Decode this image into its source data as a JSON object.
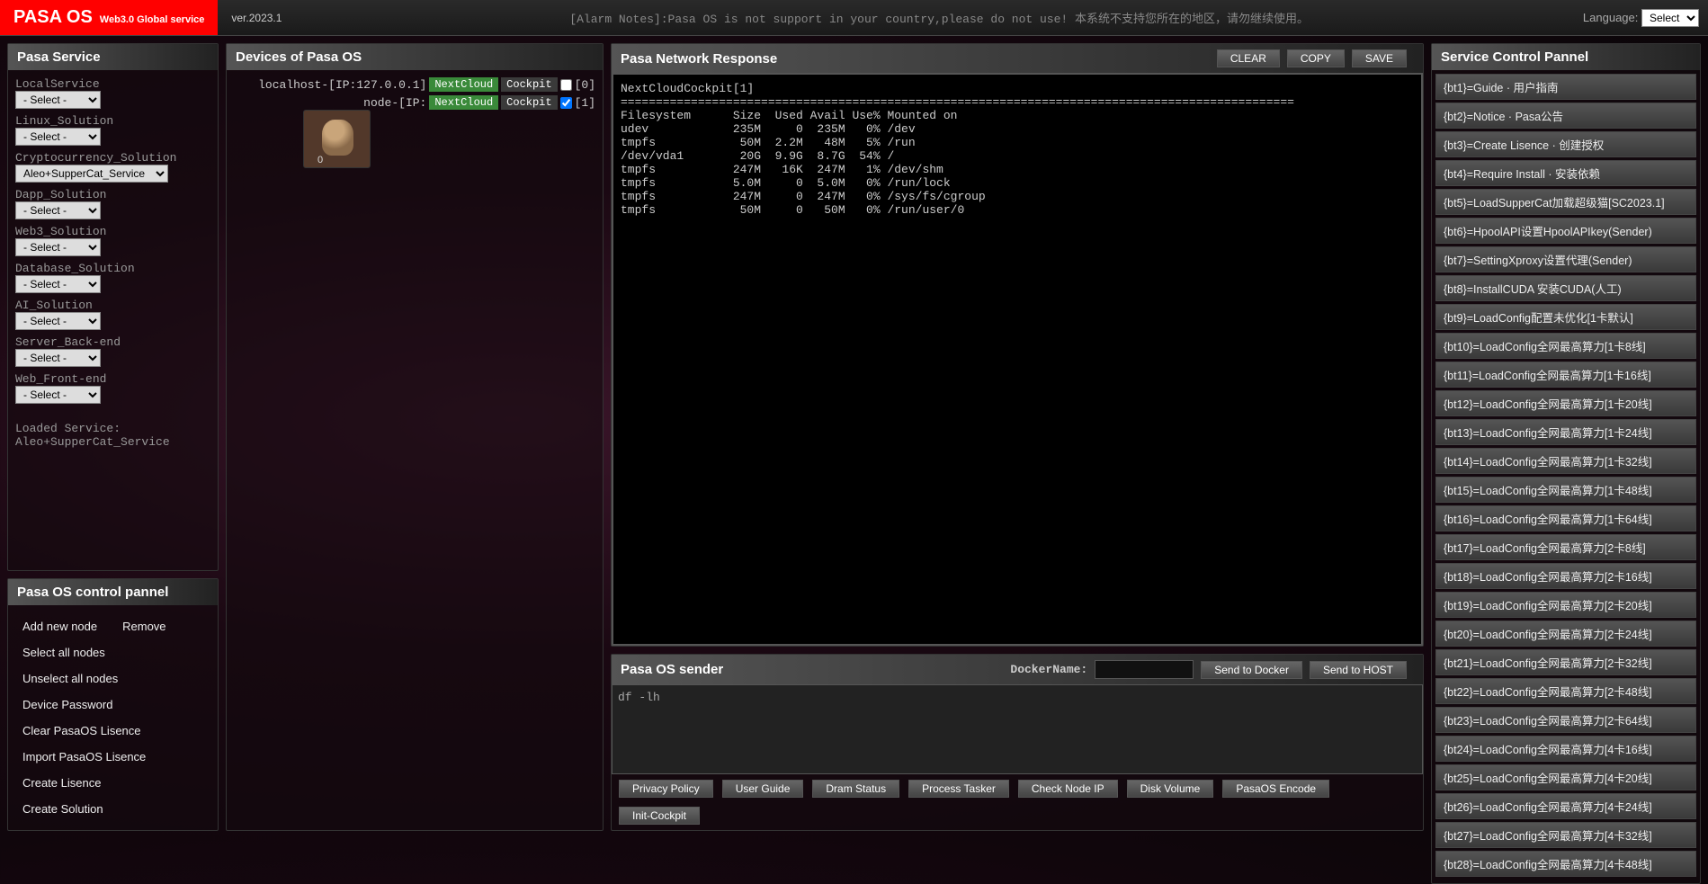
{
  "header": {
    "logo_big": "PASA  OS",
    "logo_small": "Web3.0 Global service",
    "version": "ver.2023.1",
    "alarm": "[Alarm Notes]:Pasa OS is not support in your country,please do not use! 本系统不支持您所在的地区，请勿继续使用。",
    "lang_label": "Language:",
    "lang_value": "Select"
  },
  "service": {
    "title": "Pasa Service",
    "groups": [
      {
        "label": "LocalService",
        "value": "- Select -"
      },
      {
        "label": "Linux_Solution",
        "value": "- Select -"
      },
      {
        "label": "Cryptocurrency_Solution",
        "value": "Aleo+SupperCat_Service"
      },
      {
        "label": "Dapp_Solution",
        "value": "- Select -"
      },
      {
        "label": "Web3_Solution",
        "value": "- Select -"
      },
      {
        "label": "Database_Solution",
        "value": "- Select -"
      },
      {
        "label": "AI_Solution",
        "value": "- Select -"
      },
      {
        "label": "Server_Back-end",
        "value": "- Select -"
      },
      {
        "label": "Web_Front-end",
        "value": "- Select -"
      }
    ],
    "loaded_label": "Loaded Service:",
    "loaded_value": "Aleo+SupperCat_Service"
  },
  "devices": {
    "title": "Devices of Pasa OS",
    "rows": [
      {
        "name": "localhost-[IP:127.0.0.1]",
        "b1": "NextCloud",
        "b2": "Cockpit",
        "checked": false,
        "idx": "[0]"
      },
      {
        "name": "node-[IP:",
        "b1": "NextCloud",
        "b2": "Cockpit",
        "checked": true,
        "idx": "[1]"
      }
    ]
  },
  "response": {
    "title": "Pasa Network Response",
    "btns": {
      "clear": "CLEAR",
      "copy": "COPY",
      "save": "SAVE"
    },
    "text": "NextCloudCockpit[1]\n================================================================================================\nFilesystem      Size  Used Avail Use% Mounted on\nudev            235M     0  235M   0% /dev\ntmpfs            50M  2.2M   48M   5% /run\n/dev/vda1        20G  9.9G  8.7G  54% /\ntmpfs           247M   16K  247M   1% /dev/shm\ntmpfs           5.0M     0  5.0M   0% /run/lock\ntmpfs           247M     0  247M   0% /sys/fs/cgroup\ntmpfs            50M     0   50M   0% /run/user/0"
  },
  "sender": {
    "title": "Pasa OS sender",
    "docker_label": "DockerName:",
    "send_docker": "Send to Docker",
    "send_host": "Send to HOST",
    "cmd": "df -lh",
    "btns": [
      "Privacy Policy",
      "User Guide",
      "Dram Status",
      "Process Tasker",
      "Check Node IP",
      "Disk Volume",
      "PasaOS Encode",
      "Init-Cockpit"
    ]
  },
  "control": {
    "title": "Pasa OS control pannel",
    "btns": [
      "Add new node",
      "Remove",
      "Select all nodes",
      "Unselect all nodes",
      "Device Password",
      "Clear PasaOS Lisence",
      "Import PasaOS Lisence",
      "Create Lisence",
      "Create Solution"
    ]
  },
  "scp": {
    "title": "Service Control Pannel",
    "items": [
      "{bt1}=Guide · 用户指南",
      "{bt2}=Notice · Pasa公告",
      "{bt3}=Create Lisence · 创建授权",
      "{bt4}=Require Install · 安装依赖",
      "{bt5}=LoadSupperCat加载超级猫[SC2023.1]",
      "{bt6}=HpoolAPI设置HpoolAPIkey(Sender)",
      "{bt7}=SettingXproxy设置代理(Sender)",
      "{bt8}=InstallCUDA 安装CUDA(人工)",
      "{bt9}=LoadConfig配置未优化[1卡默认]",
      "{bt10}=LoadConfig全网最高算力[1卡8线]",
      "{bt11}=LoadConfig全网最高算力[1卡16线]",
      "{bt12}=LoadConfig全网最高算力[1卡20线]",
      "{bt13}=LoadConfig全网最高算力[1卡24线]",
      "{bt14}=LoadConfig全网最高算力[1卡32线]",
      "{bt15}=LoadConfig全网最高算力[1卡48线]",
      "{bt16}=LoadConfig全网最高算力[1卡64线]",
      "{bt17}=LoadConfig全网最高算力[2卡8线]",
      "{bt18}=LoadConfig全网最高算力[2卡16线]",
      "{bt19}=LoadConfig全网最高算力[2卡20线]",
      "{bt20}=LoadConfig全网最高算力[2卡24线]",
      "{bt21}=LoadConfig全网最高算力[2卡32线]",
      "{bt22}=LoadConfig全网最高算力[2卡48线]",
      "{bt23}=LoadConfig全网最高算力[2卡64线]",
      "{bt24}=LoadConfig全网最高算力[4卡16线]",
      "{bt25}=LoadConfig全网最高算力[4卡20线]",
      "{bt26}=LoadConfig全网最高算力[4卡24线]",
      "{bt27}=LoadConfig全网最高算力[4卡32线]",
      "{bt28}=LoadConfig全网最高算力[4卡48线]"
    ]
  }
}
